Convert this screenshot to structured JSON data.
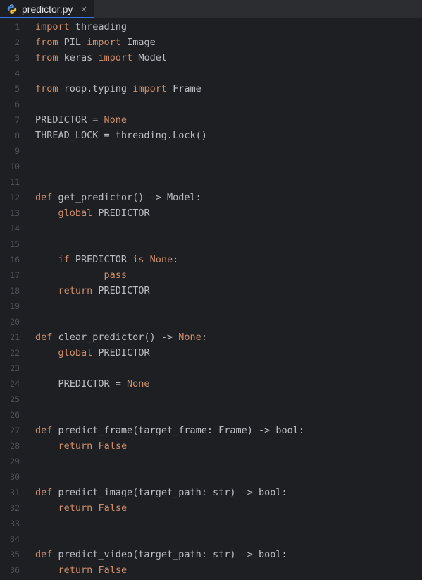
{
  "tab": {
    "filename": "predictor.py",
    "close_glyph": "×",
    "icon": "python-file-icon"
  },
  "colors": {
    "keyword": "#cf8e6d",
    "text": "#bcbec4",
    "line_number": "#4b5059",
    "background": "#1e1f22",
    "tabbar": "#2b2d30",
    "tab_accent": "#3574f0"
  },
  "lines": [
    {
      "n": "1",
      "tokens": [
        {
          "t": "import",
          "k": "kw"
        },
        {
          "t": " threading",
          "k": "tx"
        }
      ]
    },
    {
      "n": "2",
      "tokens": [
        {
          "t": "from",
          "k": "kw"
        },
        {
          "t": " PIL ",
          "k": "tx"
        },
        {
          "t": "import",
          "k": "kw"
        },
        {
          "t": " Image",
          "k": "tx"
        }
      ]
    },
    {
      "n": "3",
      "tokens": [
        {
          "t": "from",
          "k": "kw"
        },
        {
          "t": " keras ",
          "k": "tx"
        },
        {
          "t": "import",
          "k": "kw"
        },
        {
          "t": " Model",
          "k": "tx"
        }
      ]
    },
    {
      "n": "4",
      "tokens": []
    },
    {
      "n": "5",
      "tokens": [
        {
          "t": "from",
          "k": "kw"
        },
        {
          "t": " roop.typing ",
          "k": "tx"
        },
        {
          "t": "import",
          "k": "kw"
        },
        {
          "t": " Frame",
          "k": "tx"
        }
      ]
    },
    {
      "n": "6",
      "tokens": []
    },
    {
      "n": "7",
      "tokens": [
        {
          "t": "PREDICTOR = ",
          "k": "tx"
        },
        {
          "t": "None",
          "k": "kw"
        }
      ]
    },
    {
      "n": "8",
      "tokens": [
        {
          "t": "THREAD_LOCK = threading.Lock()",
          "k": "tx"
        }
      ]
    },
    {
      "n": "9",
      "tokens": []
    },
    {
      "n": "10",
      "tokens": []
    },
    {
      "n": "11",
      "tokens": []
    },
    {
      "n": "12",
      "tokens": [
        {
          "t": "def",
          "k": "kw"
        },
        {
          "t": " get_predictor() -> Model:",
          "k": "tx"
        }
      ]
    },
    {
      "n": "13",
      "tokens": [
        {
          "t": "    ",
          "k": "tx"
        },
        {
          "t": "global",
          "k": "kw"
        },
        {
          "t": " PREDICTOR",
          "k": "tx"
        }
      ]
    },
    {
      "n": "14",
      "tokens": []
    },
    {
      "n": "15",
      "tokens": []
    },
    {
      "n": "16",
      "tokens": [
        {
          "t": "    ",
          "k": "tx"
        },
        {
          "t": "if",
          "k": "kw"
        },
        {
          "t": " PREDICTOR ",
          "k": "tx"
        },
        {
          "t": "is",
          "k": "kw"
        },
        {
          "t": " ",
          "k": "tx"
        },
        {
          "t": "None",
          "k": "kw"
        },
        {
          "t": ":",
          "k": "tx"
        }
      ]
    },
    {
      "n": "17",
      "tokens": [
        {
          "t": "            ",
          "k": "tx"
        },
        {
          "t": "pass",
          "k": "kw"
        }
      ]
    },
    {
      "n": "18",
      "tokens": [
        {
          "t": "    ",
          "k": "tx"
        },
        {
          "t": "return",
          "k": "kw"
        },
        {
          "t": " PREDICTOR",
          "k": "tx"
        }
      ]
    },
    {
      "n": "19",
      "tokens": []
    },
    {
      "n": "20",
      "tokens": []
    },
    {
      "n": "21",
      "tokens": [
        {
          "t": "def",
          "k": "kw"
        },
        {
          "t": " clear_predictor() -> ",
          "k": "tx"
        },
        {
          "t": "None",
          "k": "kw"
        },
        {
          "t": ":",
          "k": "tx"
        }
      ]
    },
    {
      "n": "22",
      "tokens": [
        {
          "t": "    ",
          "k": "tx"
        },
        {
          "t": "global",
          "k": "kw"
        },
        {
          "t": " PREDICTOR",
          "k": "tx"
        }
      ]
    },
    {
      "n": "23",
      "tokens": []
    },
    {
      "n": "24",
      "tokens": [
        {
          "t": "    PREDICTOR = ",
          "k": "tx"
        },
        {
          "t": "None",
          "k": "kw"
        }
      ]
    },
    {
      "n": "25",
      "tokens": []
    },
    {
      "n": "26",
      "tokens": []
    },
    {
      "n": "27",
      "tokens": [
        {
          "t": "def",
          "k": "kw"
        },
        {
          "t": " predict_frame(target_frame: Frame) -> bool:",
          "k": "tx"
        }
      ]
    },
    {
      "n": "28",
      "tokens": [
        {
          "t": "    ",
          "k": "tx"
        },
        {
          "t": "return",
          "k": "kw"
        },
        {
          "t": " ",
          "k": "tx"
        },
        {
          "t": "False",
          "k": "kw"
        }
      ]
    },
    {
      "n": "29",
      "tokens": []
    },
    {
      "n": "30",
      "tokens": []
    },
    {
      "n": "31",
      "tokens": [
        {
          "t": "def",
          "k": "kw"
        },
        {
          "t": " predict_image(target_path: str) -> bool:",
          "k": "tx"
        }
      ]
    },
    {
      "n": "32",
      "tokens": [
        {
          "t": "    ",
          "k": "tx"
        },
        {
          "t": "return",
          "k": "kw"
        },
        {
          "t": " ",
          "k": "tx"
        },
        {
          "t": "False",
          "k": "kw"
        }
      ]
    },
    {
      "n": "33",
      "tokens": []
    },
    {
      "n": "34",
      "tokens": []
    },
    {
      "n": "35",
      "tokens": [
        {
          "t": "def",
          "k": "kw"
        },
        {
          "t": " predict_video(target_path: str) -> bool:",
          "k": "tx"
        }
      ]
    },
    {
      "n": "36",
      "tokens": [
        {
          "t": "    ",
          "k": "tx"
        },
        {
          "t": "return",
          "k": "kw"
        },
        {
          "t": " ",
          "k": "tx"
        },
        {
          "t": "False",
          "k": "kw"
        }
      ]
    }
  ]
}
